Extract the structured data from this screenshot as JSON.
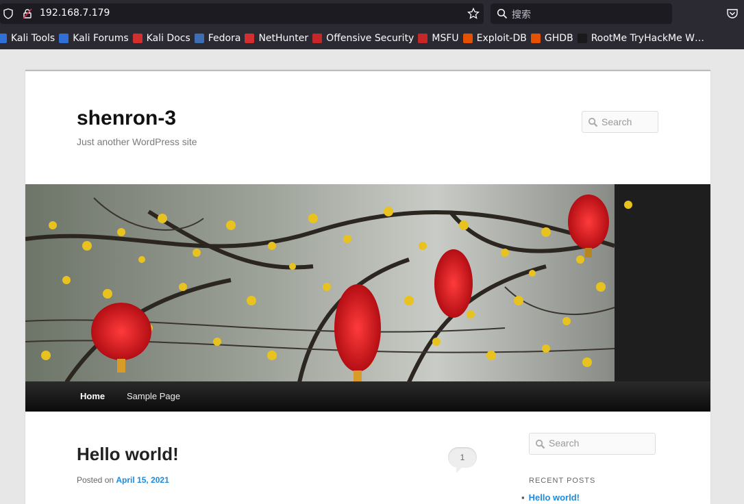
{
  "browser": {
    "url": "192.168.7.179",
    "search_placeholder": "搜索"
  },
  "bookmarks": [
    {
      "label": "Kali Tools",
      "color": "#2f6fd6"
    },
    {
      "label": "Kali Forums",
      "color": "#2f6fd6"
    },
    {
      "label": "Kali Docs",
      "color": "#d32f2f"
    },
    {
      "label": "Fedora",
      "color": "#3c6eb4"
    },
    {
      "label": "NetHunter",
      "color": "#d32f2f"
    },
    {
      "label": "Offensive Security",
      "color": "#c62828"
    },
    {
      "label": "MSFU",
      "color": "#c62828"
    },
    {
      "label": "Exploit-DB",
      "color": "#e65100"
    },
    {
      "label": "GHDB",
      "color": "#e65100"
    },
    {
      "label": "RootMe TryHackMe W…",
      "color": "#1a1a1a"
    }
  ],
  "site": {
    "title": "shenron-3",
    "description": "Just another WordPress site",
    "header_search_placeholder": "Search"
  },
  "nav": {
    "home": "Home",
    "sample": "Sample Page"
  },
  "post": {
    "title": "Hello world!",
    "comment_count": "1",
    "posted_on_label": "Posted on",
    "date": "April 15, 2021"
  },
  "sidebar": {
    "search_placeholder": "Search",
    "recent_posts_title": "RECENT POSTS",
    "recent_posts": [
      "Hello world!"
    ]
  }
}
